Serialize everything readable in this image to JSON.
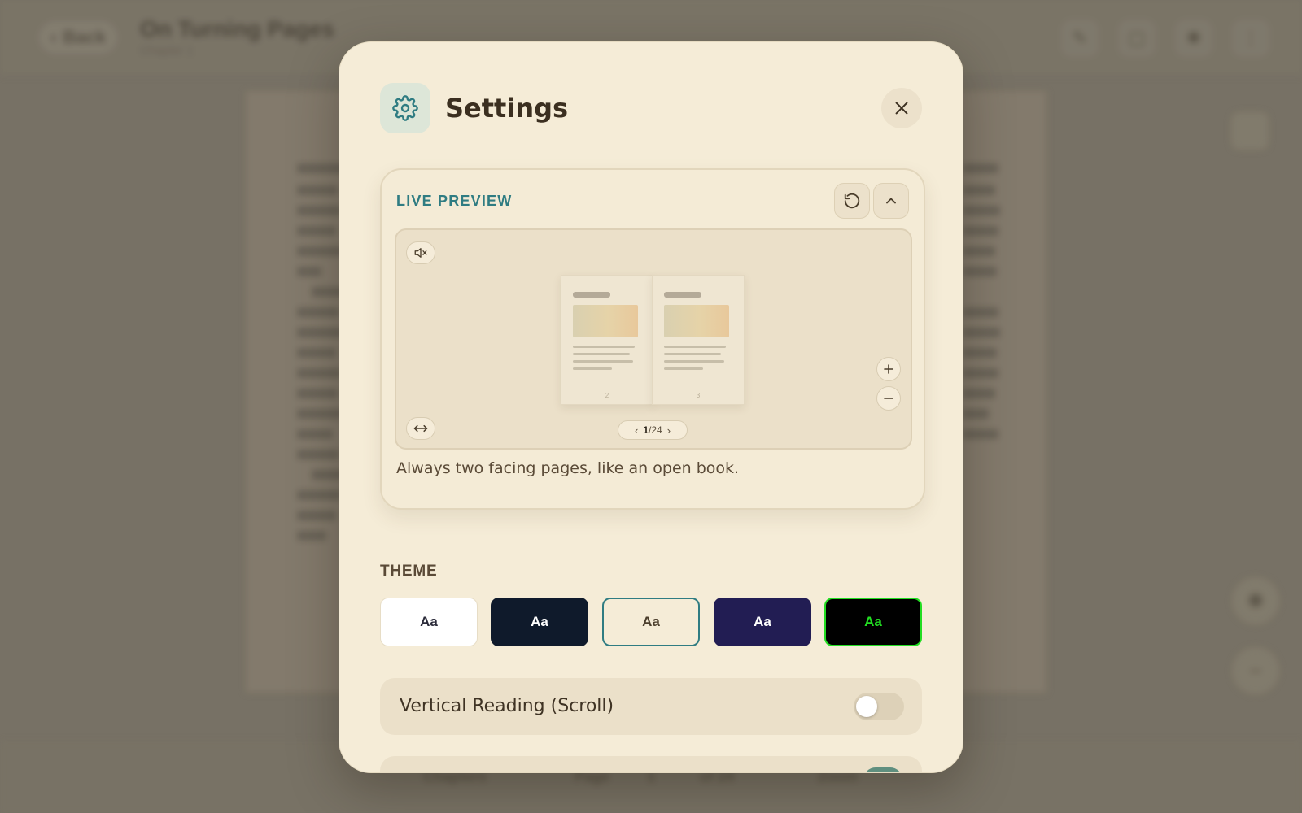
{
  "background": {
    "back_label": "Back",
    "book_title": "On Turning Pages",
    "book_subtitle": "Chapter 1",
    "bottom_items": [
      "Chapters",
      "Page",
      "1",
      "of 24",
      "Zoom"
    ]
  },
  "settings": {
    "title": "Settings",
    "icons": {
      "header": "gear-icon",
      "close": "close-icon",
      "reset": "reset-icon",
      "collapse": "chevron-up-icon",
      "mute": "mute-icon",
      "fit_width": "fit-width-icon",
      "zoom_in": "plus-icon",
      "zoom_out": "minus-icon"
    },
    "preview": {
      "label": "LIVE PREVIEW",
      "description": "Always two facing pages, like an open book.",
      "page_current": "1",
      "page_total": "/24",
      "left_page_number": "2",
      "right_page_number": "3"
    },
    "theme": {
      "label": "THEME",
      "options": [
        {
          "label": "Aa",
          "name": "light",
          "bg": "#ffffff",
          "fg": "#2b2b3a"
        },
        {
          "label": "Aa",
          "name": "dark",
          "bg": "#0f1a2b",
          "fg": "#ffffff"
        },
        {
          "label": "Aa",
          "name": "sepia",
          "bg": "#f5ecd7",
          "fg": "#4a3d2b",
          "selected": true
        },
        {
          "label": "Aa",
          "name": "midnight",
          "bg": "#221d53",
          "fg": "#ffffff"
        },
        {
          "label": "Aa",
          "name": "terminal",
          "bg": "#000000",
          "fg": "#22dd22"
        }
      ]
    },
    "vertical_reading": {
      "label": "Vertical Reading (Scroll)",
      "enabled": false
    }
  },
  "colors": {
    "accent": "#2f7c82",
    "modal_bg": "#f5ecd7",
    "row_bg": "#ebe0c9"
  }
}
